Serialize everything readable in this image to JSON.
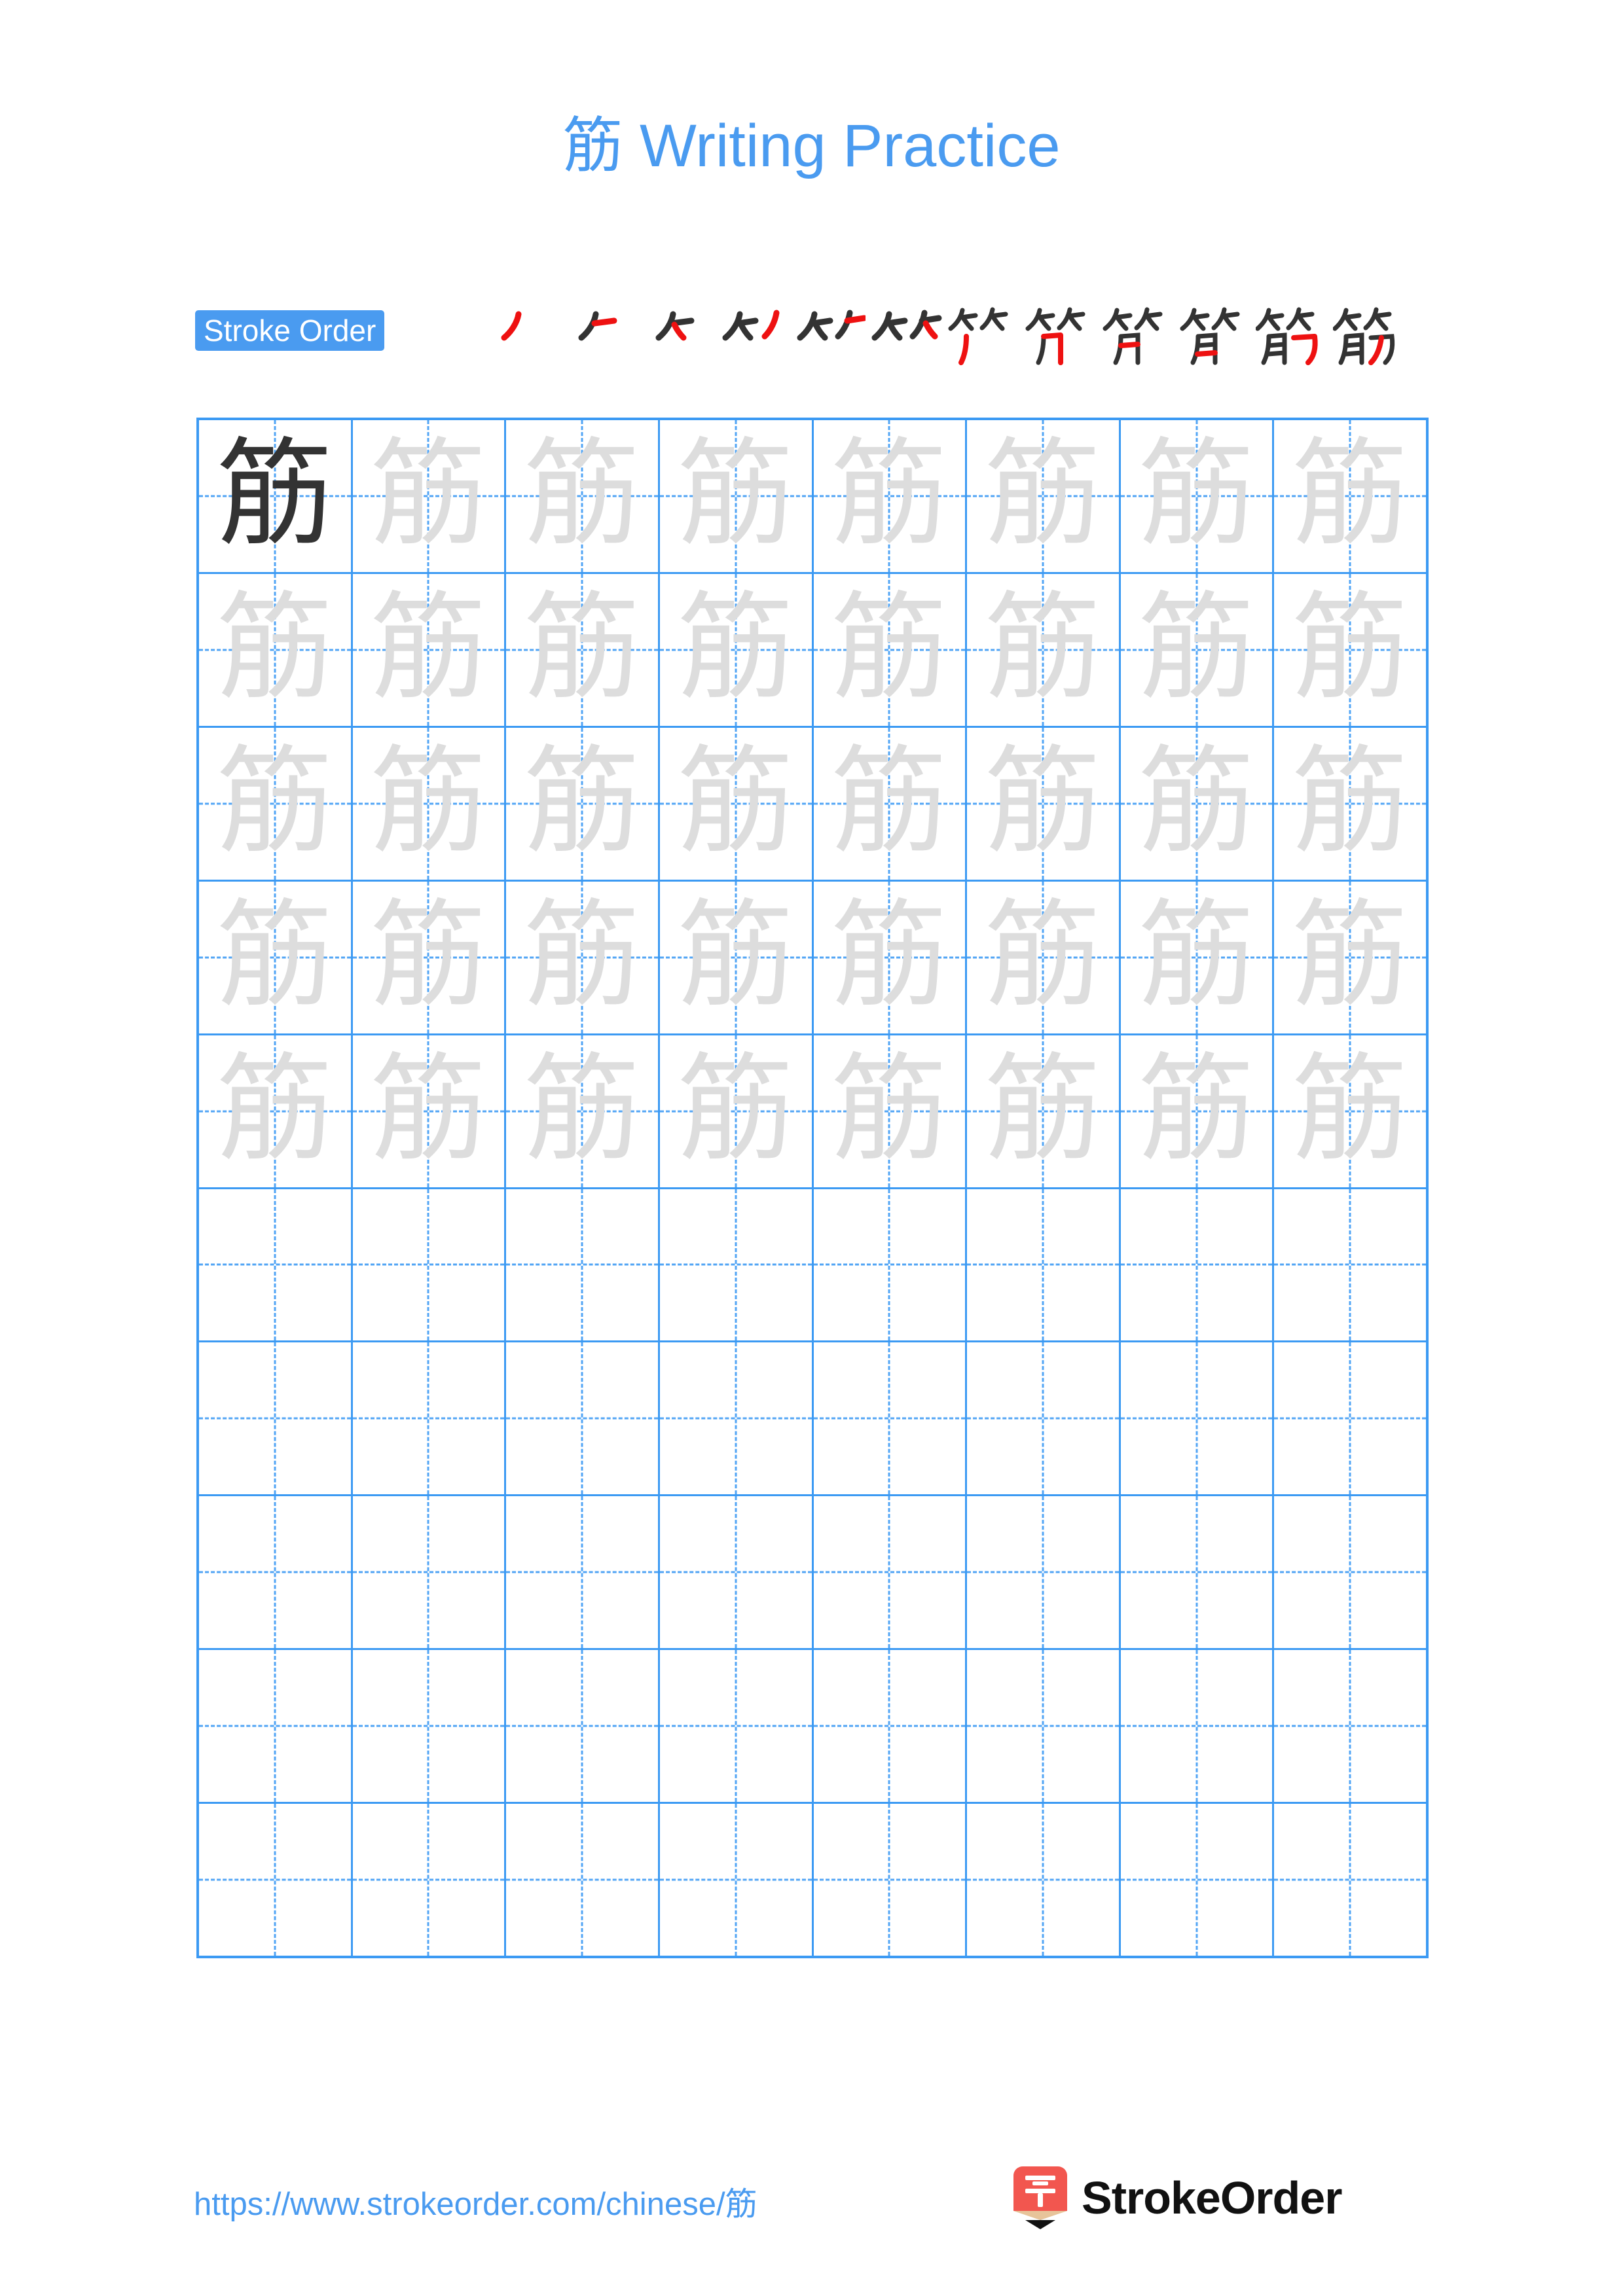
{
  "page": {
    "title": "筋 Writing Practice",
    "character": "筋",
    "background_color": "#ffffff",
    "accent_color": "#4a9bf0",
    "grid_line_color": "#3c9af3",
    "trace_ink_color": "#dddddd",
    "model_ink_color": "#333333",
    "new_stroke_color": "#ee1111"
  },
  "stroke_order": {
    "badge_label": "Stroke Order",
    "total_strokes": 12,
    "steps": [
      {
        "index": 1,
        "glyph": "丿",
        "cumulative": "丿"
      },
      {
        "index": 2,
        "glyph": "一",
        "cumulative": "⺊"
      },
      {
        "index": 3,
        "glyph": "丶",
        "cumulative": "𠂉"
      },
      {
        "index": 4,
        "glyph": "丿",
        "cumulative": "ケ"
      },
      {
        "index": 5,
        "glyph": "一",
        "cumulative": "𥫗"
      },
      {
        "index": 6,
        "glyph": "丶",
        "cumulative": "竹"
      },
      {
        "index": 7,
        "glyph": "丿",
        "cumulative": "⺮丿"
      },
      {
        "index": 8,
        "glyph": "㇆",
        "cumulative": "⺮冂"
      },
      {
        "index": 9,
        "glyph": "一",
        "cumulative": "⺮冂一"
      },
      {
        "index": 10,
        "glyph": "一",
        "cumulative": "⺮月"
      },
      {
        "index": 11,
        "glyph": "㇈",
        "cumulative": "⺮月乃"
      },
      {
        "index": 12,
        "glyph": "丿",
        "cumulative": "筋"
      }
    ]
  },
  "practice_grid": {
    "columns": 8,
    "rows": 10,
    "filled_rows": 5,
    "model_cell": {
      "row": 0,
      "column": 0
    },
    "rows_data": [
      [
        "筋",
        "筋",
        "筋",
        "筋",
        "筋",
        "筋",
        "筋",
        "筋"
      ],
      [
        "筋",
        "筋",
        "筋",
        "筋",
        "筋",
        "筋",
        "筋",
        "筋"
      ],
      [
        "筋",
        "筋",
        "筋",
        "筋",
        "筋",
        "筋",
        "筋",
        "筋"
      ],
      [
        "筋",
        "筋",
        "筋",
        "筋",
        "筋",
        "筋",
        "筋",
        "筋"
      ],
      [
        "筋",
        "筋",
        "筋",
        "筋",
        "筋",
        "筋",
        "筋",
        "筋"
      ],
      [
        "",
        "",
        "",
        "",
        "",
        "",
        "",
        ""
      ],
      [
        "",
        "",
        "",
        "",
        "",
        "",
        "",
        ""
      ],
      [
        "",
        "",
        "",
        "",
        "",
        "",
        "",
        ""
      ],
      [
        "",
        "",
        "",
        "",
        "",
        "",
        "",
        ""
      ],
      [
        "",
        "",
        "",
        "",
        "",
        "",
        "",
        ""
      ]
    ]
  },
  "footer": {
    "url": "https://www.strokeorder.com/chinese/筋",
    "brand_name": "StrokeOrder",
    "brand_mark_character": "字",
    "brand_mark_color": "#f2564f",
    "brand_mark_icon": "pencil-icon"
  }
}
